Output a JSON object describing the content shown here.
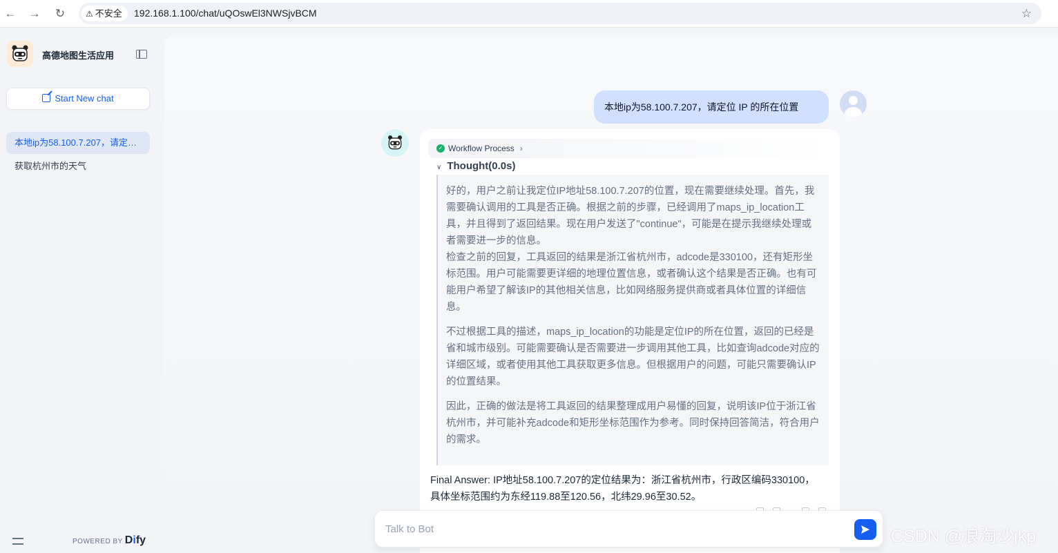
{
  "browser": {
    "security_label": "不安全",
    "url": "192.168.1.100/chat/uQOswEl3NWSjvBCM"
  },
  "sidebar": {
    "app_title": "高德地图生活应用",
    "new_chat_label": "Start New chat",
    "conversations": [
      {
        "label": "本地ip为58.100.7.207，请定位 IP 的所在位置",
        "active": true
      },
      {
        "label": "获取杭州市的天气",
        "active": false
      }
    ],
    "powered_by": "POWERED BY",
    "brand": "Dify"
  },
  "chat": {
    "user_message": "本地ip为58.100.7.207，请定位 IP 的所在位置",
    "workflow_label": "Workflow Process",
    "thought_title": "Thought(0.0s)",
    "thought_paragraphs": [
      "好的，用户之前让我定位IP地址58.100.7.207的位置，现在需要继续处理。首先，我需要确认调用的工具是否正确。根据之前的步骤，已经调用了maps_ip_location工具，并且得到了返回结果。现在用户发送了\"continue\"，可能是在提示我继续处理或者需要进一步的信息。",
      "检查之前的回复，工具返回的结果是浙江省杭州市，adcode是330100，还有矩形坐标范围。用户可能需要更详细的地理位置信息，或者确认这个结果是否正确。也有可能用户希望了解该IP的其他相关信息，比如网络服务提供商或者具体位置的详细信息。",
      "不过根据工具的描述，maps_ip_location的功能是定位IP的所在位置，返回的已经是省和城市级别。可能需要确认是否需要进一步调用其他工具，比如查询adcode对应的详细区域，或者使用其他工具获取更多信息。但根据用户的问题，可能只需要确认IP的位置结果。",
      "因此，正确的做法是将工具返回的结果整理成用户易懂的回复，说明该IP位于浙江省杭州市，并可能补充adcode和矩形坐标范围作为参考。同时保持回答简洁，符合用户的需求。"
    ],
    "final_answer": "Final Answer: IP地址58.100.7.207的定位结果为：浙江省杭州市，行政区编码330100，具体坐标范围约为东经119.88至120.56，北纬29.96至30.52。",
    "input_placeholder": "Talk to Bot"
  },
  "watermark": "CSDN @浪淘沙jkp",
  "colors": {
    "accent": "#155eef",
    "user_bubble": "#d1e0ff",
    "success": "#17b26a"
  }
}
